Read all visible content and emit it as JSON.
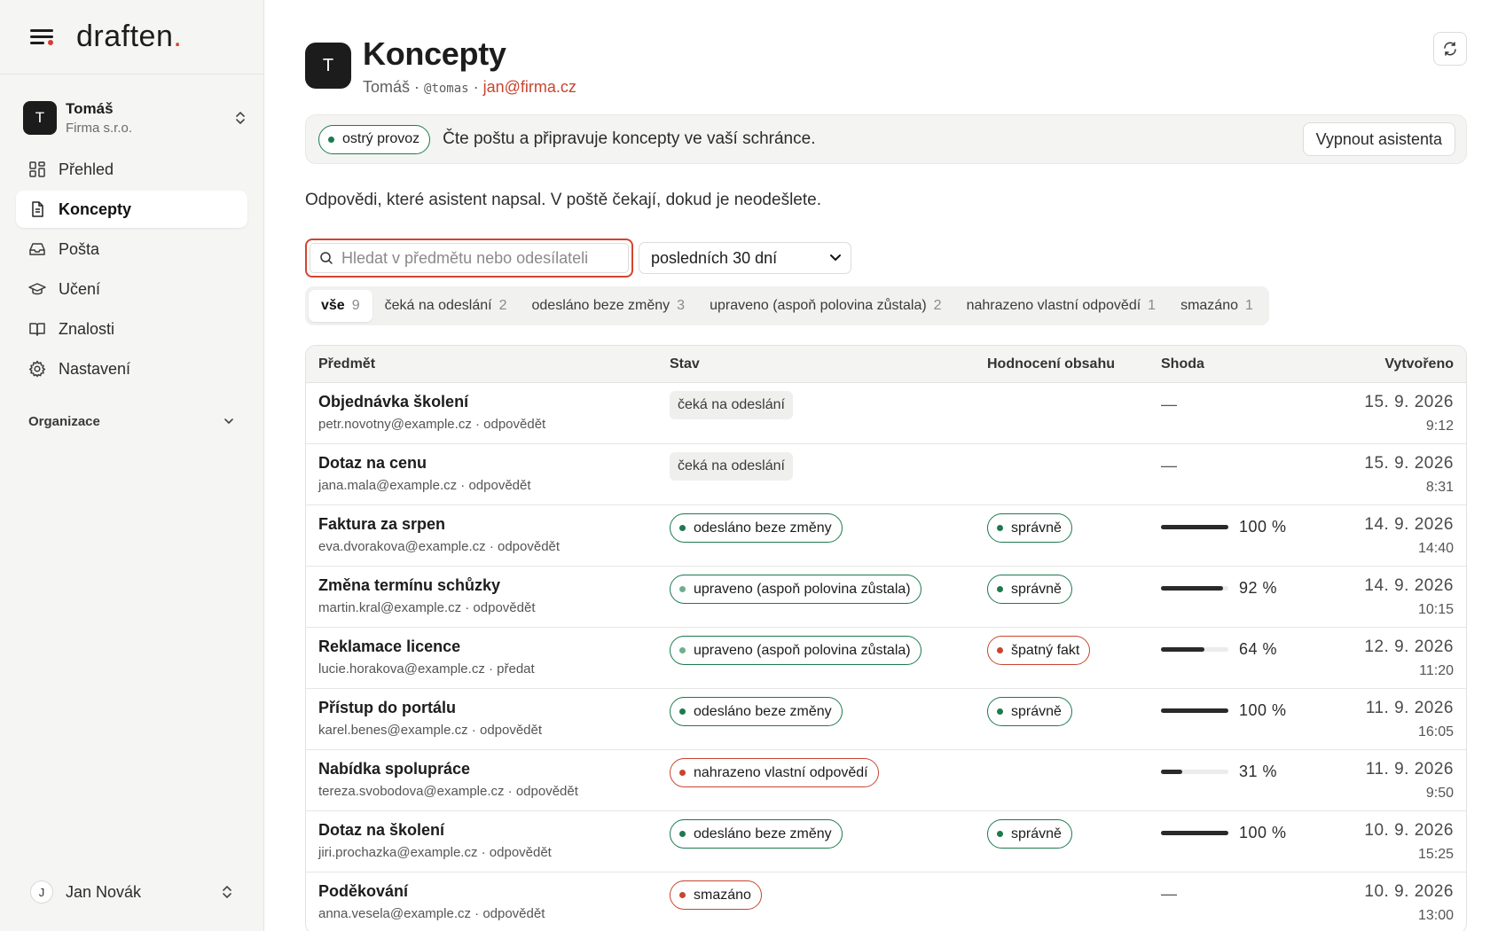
{
  "brand": {
    "name": "draften",
    "dot": "."
  },
  "org": {
    "initial": "T",
    "name": "Tomáš",
    "company": "Firma s.r.o."
  },
  "nav": {
    "items": [
      {
        "label": "Přehled",
        "icon": "grid-icon"
      },
      {
        "label": "Koncepty",
        "icon": "document-icon"
      },
      {
        "label": "Pošta",
        "icon": "inbox-icon"
      },
      {
        "label": "Učení",
        "icon": "graduation-cap-icon"
      },
      {
        "label": "Znalosti",
        "icon": "book-icon"
      },
      {
        "label": "Nastavení",
        "icon": "gear-icon"
      }
    ],
    "active": "Koncepty",
    "section_label": "Organizace"
  },
  "user": {
    "initial": "J",
    "name": "Jan Novák"
  },
  "header": {
    "avatar": "T",
    "title": "Koncepty",
    "name": "Tomáš",
    "sep": " · ",
    "handle": "@tomas",
    "email": "jan@firma.cz"
  },
  "status": {
    "badge": "ostrý provoz",
    "text": "Čte poštu a připravuje koncepty ve vaší schránce.",
    "button": "Vypnout asistenta"
  },
  "intro": "Odpovědi, které asistent napsal. V poště čekají, dokud je neodešlete.",
  "search": {
    "placeholder": "Hledat v předmětu nebo odesílateli",
    "value": ""
  },
  "period": {
    "selected": "posledních 30 dní"
  },
  "tabs": [
    {
      "label": "vše",
      "count": "9"
    },
    {
      "label": "čeká na odeslání",
      "count": "2"
    },
    {
      "label": "odesláno beze změny",
      "count": "3"
    },
    {
      "label": "upraveno (aspoň polovina zůstala)",
      "count": "2"
    },
    {
      "label": "nahrazeno vlastní odpovědí",
      "count": "1"
    },
    {
      "label": "smazáno",
      "count": "1"
    }
  ],
  "table": {
    "headers": [
      "Předmět",
      "Stav",
      "Hodnocení obsahu",
      "Shoda",
      "Vytvořeno"
    ],
    "rows": [
      {
        "subject": "Objednávka školení",
        "from": "petr.novotny@example.cz · odpovědět",
        "status": "čeká na odeslání",
        "status_style": "grey",
        "rating": "",
        "rating_style": "",
        "match": "—",
        "match_value": null,
        "date": "15. 9. 2026",
        "time": "9:12"
      },
      {
        "subject": "Dotaz na cenu",
        "from": "jana.mala@example.cz · odpovědět",
        "status": "čeká na odeslání",
        "status_style": "grey",
        "rating": "",
        "rating_style": "",
        "match": "—",
        "match_value": null,
        "date": "15. 9. 2026",
        "time": "8:31"
      },
      {
        "subject": "Faktura za srpen",
        "from": "eva.dvorakova@example.cz · odpovědět",
        "status": "odesláno beze změny",
        "status_style": "green",
        "rating": "správně",
        "rating_style": "green",
        "match": "100 %",
        "match_value": 100,
        "date": "14. 9. 2026",
        "time": "14:40"
      },
      {
        "subject": "Změna termínu schůzky",
        "from": "martin.kral@example.cz · odpovědět",
        "status": "upraveno (aspoň polovina zůstala)",
        "status_style": "green-light",
        "rating": "správně",
        "rating_style": "green",
        "match": "92 %",
        "match_value": 92,
        "date": "14. 9. 2026",
        "time": "10:15"
      },
      {
        "subject": "Reklamace licence",
        "from": "lucie.horakova@example.cz · předat",
        "status": "upraveno (aspoň polovina zůstala)",
        "status_style": "green-light",
        "rating": "špatný fakt",
        "rating_style": "red",
        "match": "64 %",
        "match_value": 64,
        "date": "12. 9. 2026",
        "time": "11:20"
      },
      {
        "subject": "Přístup do portálu",
        "from": "karel.benes@example.cz · odpovědět",
        "status": "odesláno beze změny",
        "status_style": "green",
        "rating": "správně",
        "rating_style": "green",
        "match": "100 %",
        "match_value": 100,
        "date": "11. 9. 2026",
        "time": "16:05"
      },
      {
        "subject": "Nabídka spolupráce",
        "from": "tereza.svobodova@example.cz · odpovědět",
        "status": "nahrazeno vlastní odpovědí",
        "status_style": "red",
        "rating": "",
        "rating_style": "",
        "match": "31 %",
        "match_value": 31,
        "date": "11. 9. 2026",
        "time": "9:50"
      },
      {
        "subject": "Dotaz na školení",
        "from": "jiri.prochazka@example.cz · odpovědět",
        "status": "odesláno beze změny",
        "status_style": "green",
        "rating": "správně",
        "rating_style": "green",
        "match": "100 %",
        "match_value": 100,
        "date": "10. 9. 2026",
        "time": "15:25"
      },
      {
        "subject": "Poděkování",
        "from": "anna.vesela@example.cz · odpovědět",
        "status": "smazáno",
        "status_style": "red",
        "rating": "",
        "rating_style": "",
        "match": "—",
        "match_value": null,
        "date": "10. 9. 2026",
        "time": "13:00"
      }
    ]
  },
  "colors": {
    "accent": "#d4402e",
    "green": "#1d7a4f",
    "green_light": "#6fae8c",
    "red": "#c8452f"
  }
}
